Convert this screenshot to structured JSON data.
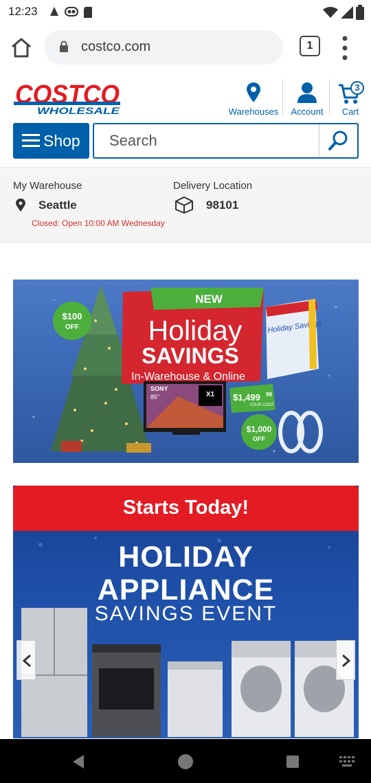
{
  "status_bar": {
    "time": "12:23"
  },
  "browser": {
    "url": "costco.com",
    "tab_count": "1"
  },
  "header": {
    "logo_text_top": "COSTCO",
    "logo_text_bottom": "WHOLESALE",
    "nav": {
      "warehouses": "Warehouses",
      "account": "Account",
      "cart": "Cart",
      "cart_count": "3"
    },
    "shop_label": "Shop",
    "search_placeholder": "Search"
  },
  "warehouse": {
    "my_warehouse_label": "My Warehouse",
    "city": "Seattle",
    "status": "Closed: Open 10:00 AM Wednesday",
    "delivery_label": "Delivery Location",
    "zip": "98101"
  },
  "banner_holiday": {
    "badge_100": "$100",
    "badge_100_sub": "OFF",
    "new_label": "NEW",
    "headline_1": "Holiday",
    "headline_2": "SAVINGS",
    "subline": "In-Warehouse & Online",
    "tv_brand": "SONY",
    "tv_size": "85\"",
    "tv_model": "X1",
    "price": "$1,499",
    "price_cents": "99",
    "price_sub": "YOUR COST",
    "off_1000": "$1,000",
    "off_1000_sub": "OFF",
    "catalog_title": "Holiday Savings"
  },
  "banner_appliance": {
    "strip": "Starts Today!",
    "line1": "HOLIDAY",
    "line2": "APPLIANCE",
    "line3": "SAVINGS EVENT"
  },
  "icons": [
    "home-icon",
    "lock-icon",
    "menu-dots-icon",
    "map-pin-icon",
    "account-icon",
    "cart-icon",
    "search-icon",
    "box-icon",
    "chevron-left-icon",
    "chevron-right-icon"
  ],
  "colors": {
    "costco_blue": "#0060a9",
    "costco_red": "#e31b23"
  }
}
